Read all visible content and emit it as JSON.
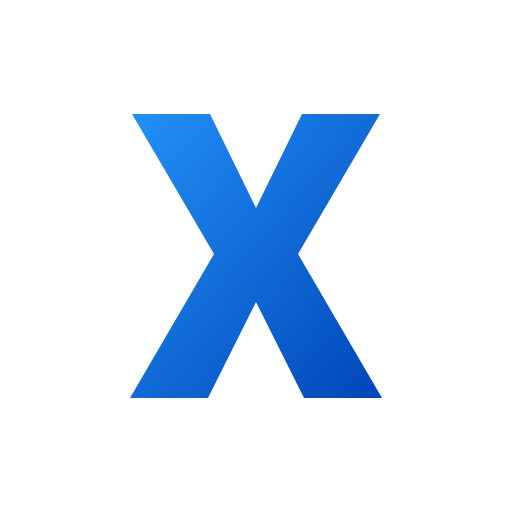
{
  "logo": {
    "letter": "X",
    "icon": "letter-x-logo-icon",
    "gradient": {
      "start": "#2390f6",
      "end": "#0046b8"
    },
    "background": "#ffffff"
  }
}
